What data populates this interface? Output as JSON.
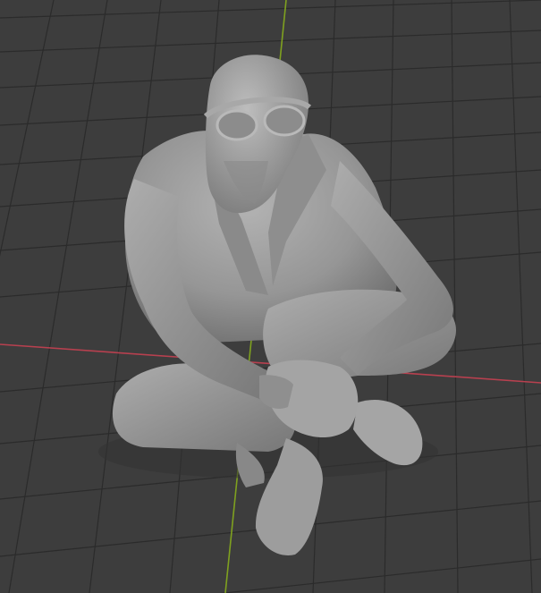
{
  "viewport": {
    "view": "perspective",
    "background_color": "#3d3d3d",
    "grid_line_color": "#2b2b2b",
    "x_axis_color": "#b8404f",
    "y_axis_color": "#7fa11f"
  },
  "scene": {
    "active_object": "seated-figure-sculpt",
    "shading": "solid",
    "object_color": "#9a9a9a"
  }
}
